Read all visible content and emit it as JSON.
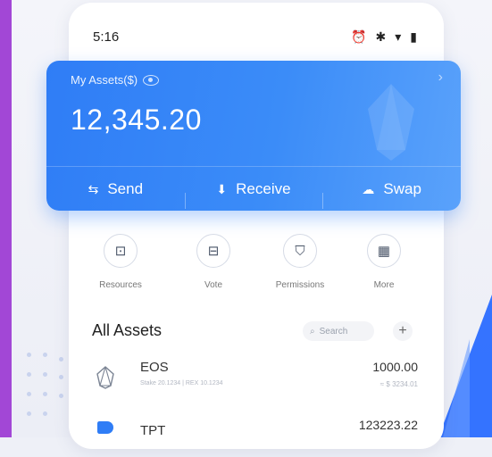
{
  "status_bar": {
    "time": "5:16",
    "icons": [
      "alarm-icon",
      "bluetooth-icon",
      "wifi-icon",
      "battery-icon"
    ]
  },
  "asset_card": {
    "label": "My Assets($)",
    "value": "12,345.20",
    "actions": [
      {
        "label": "Send",
        "icon": "send-icon"
      },
      {
        "label": "Receive",
        "icon": "receive-icon"
      },
      {
        "label": "Swap",
        "icon": "swap-icon"
      }
    ],
    "color_start": "#2f7df6",
    "color_end": "#5aa2fb"
  },
  "shortcuts": [
    {
      "label": "Resources",
      "icon": "chip-icon"
    },
    {
      "label": "Vote",
      "icon": "ballot-box-icon"
    },
    {
      "label": "Permissions",
      "icon": "shield-icon"
    },
    {
      "label": "More",
      "icon": "grid-icon"
    }
  ],
  "assets": {
    "title": "All Assets",
    "search_placeholder": "Search",
    "add_label": "+",
    "rows": [
      {
        "name": "EOS",
        "sub": "Stake 20.1234  |  REX 10.1234",
        "amount": "1000.00",
        "fiat": "≈ $ 3234.01",
        "icon": "eos-icon"
      },
      {
        "name": "TPT",
        "sub": "",
        "amount": "123223.22",
        "fiat": "",
        "icon": "tpt-icon"
      }
    ]
  },
  "accent_color": "#2f7df6"
}
